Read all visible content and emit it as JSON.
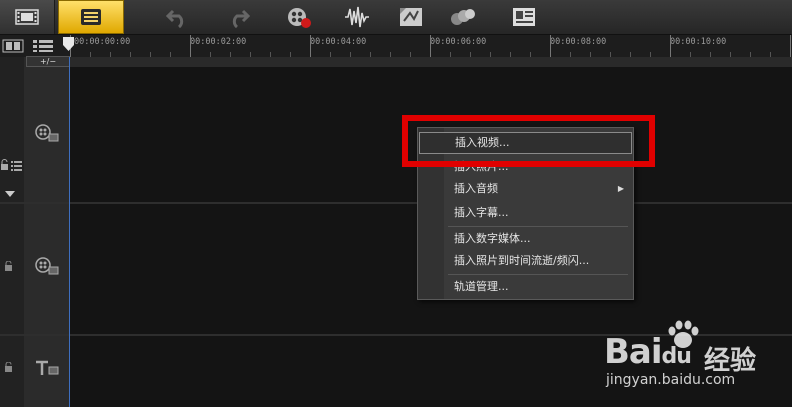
{
  "toolbar": {
    "buttons": [
      {
        "name": "storyboard-view-button",
        "icon": "filmstrip-icon"
      },
      {
        "name": "timeline-view-button",
        "icon": "timeline-icon",
        "active": true
      },
      {
        "name": "undo-button",
        "icon": "undo-icon"
      },
      {
        "name": "redo-button",
        "icon": "redo-icon"
      },
      {
        "name": "record-capture-button",
        "icon": "record-icon"
      },
      {
        "name": "sound-mixer-button",
        "icon": "waveform-icon"
      },
      {
        "name": "auto-music-button",
        "icon": "music-icon"
      },
      {
        "name": "motion-tracking-button",
        "icon": "spheres-icon"
      },
      {
        "name": "subtitle-editor-button",
        "icon": "subtitle-icon"
      }
    ]
  },
  "ruler": {
    "labels": [
      "00:00:00:00",
      "00:00:02:00",
      "00:00:04:00",
      "00:00:06:00",
      "00:00:08:00",
      "00:00:10:00"
    ]
  },
  "zoom_control": {
    "label": "+/−"
  },
  "context_menu": {
    "items": [
      {
        "label": "插入视频...",
        "highlighted": true
      },
      {
        "label": "插入照片..."
      },
      {
        "label": "插入音频",
        "submenu": true
      },
      {
        "label": "插入字幕..."
      },
      {
        "label": "插入数字媒体..."
      },
      {
        "label": "插入照片到时间流逝/频闪..."
      },
      {
        "label": "轨道管理..."
      }
    ],
    "submenu_arrow": "▶"
  },
  "watermark": {
    "logo": "Bai",
    "logo_mid": "du",
    "cn": "经验",
    "url": "jingyan.baidu.com"
  },
  "colors": {
    "highlight_box": "#e00000",
    "active_tab": "#f4c21a",
    "cursor_line": "#3e6fbf"
  }
}
